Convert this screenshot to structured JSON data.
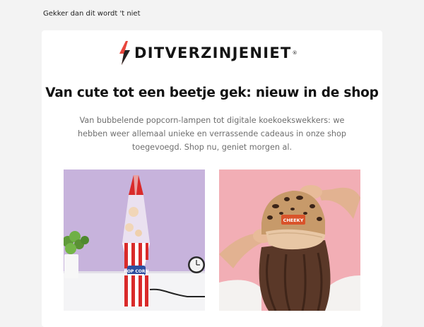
{
  "preheader": "Gekker dan dit wordt 't niet",
  "brand": {
    "name": "DITVERZINJENIET",
    "trademark": "®",
    "accent_color": "#e8463c"
  },
  "headline": "Van cute tot een beetje gek: nieuw in de shop",
  "intro": "Van bubbelende popcorn-lampen tot digitale koekoekswekkers: we hebben weer allemaal unieke en verrassende cadeaus in onze shop toegevoegd. Shop nu, geniet morgen al.",
  "products": [
    {
      "name": "popcorn-lava-lamp",
      "lamp_label": "POP CORN",
      "background": "#c7b3dc"
    },
    {
      "name": "leopard-cap",
      "cap_label": "CHEEKY",
      "background": "#f2aeb5"
    }
  ]
}
